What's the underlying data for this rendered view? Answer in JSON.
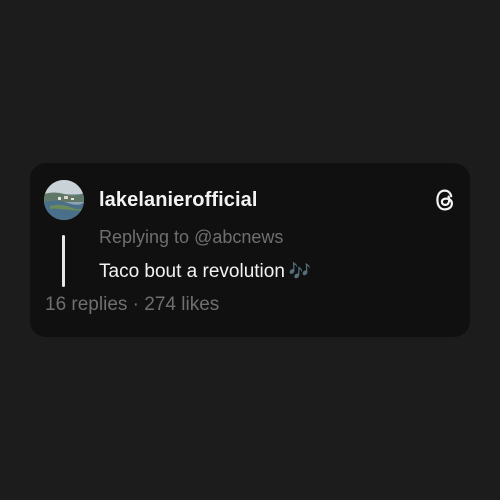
{
  "post": {
    "username": "lakelanierofficial",
    "reply_prefix": "Replying to",
    "reply_handle": "@abcnews",
    "text": "Taco bout a revolution",
    "emoji": "🎶",
    "replies": "16 replies",
    "separator": " · ",
    "likes": "274 likes"
  },
  "icons": {
    "avatar": "lake-aerial-avatar",
    "logo": "threads-icon",
    "emoji": "musical-notes-icon"
  },
  "colors": {
    "background": "#1c1c1c",
    "card": "#101010",
    "primary_text": "#f3f3f3",
    "secondary_text": "#6f6f6f"
  }
}
